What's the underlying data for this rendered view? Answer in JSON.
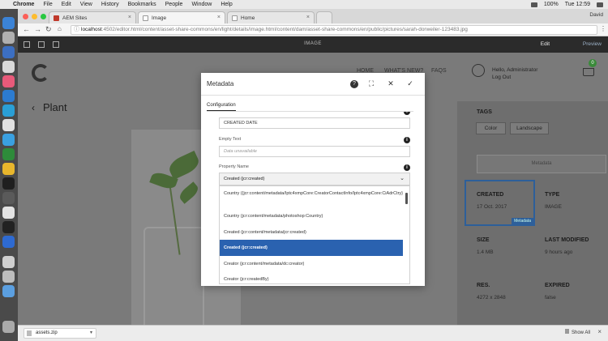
{
  "menubar": {
    "items": [
      "Chrome",
      "File",
      "Edit",
      "View",
      "History",
      "Bookmarks",
      "People",
      "Window",
      "Help"
    ],
    "battery": "100%",
    "clock": "Tue 12:59",
    "user": "David"
  },
  "browser": {
    "tabs": [
      {
        "label": "AEM Sites"
      },
      {
        "label": "Image"
      },
      {
        "label": "Home"
      }
    ],
    "person": "David",
    "url_host": "localhost",
    "url_rest": ":4502/editor.html/content/asset-share-commons/en/light/details/image.html/content/dam/asset-share-commons/en/public/pictures/sarah-dorweiler-123483.jpg"
  },
  "editor": {
    "title": "IMAGE",
    "edit_label": "Edit",
    "preview_label": "Preview"
  },
  "page": {
    "title": "Plant",
    "nav": [
      "HOME",
      "WHAT'S NEW?",
      "FAQS"
    ],
    "greeting": "Hello, Administrator",
    "logout": "Log Out",
    "cart_count": "0",
    "tags_label": "TAGS",
    "tags": [
      "Color",
      "Landscape"
    ],
    "metadata_box": "Metadata",
    "created_label": "CREATED",
    "created_value": "17 Oct. 2017",
    "metadata_tag": "Metadata",
    "type_label": "TYPE",
    "type_value": "IMAGE",
    "size_label": "SIZE",
    "size_value": "1.4 MB",
    "modified_label": "LAST MODIFIED",
    "modified_value": "9 hours ago",
    "res_label": "RES.",
    "res_value": "4272 x 2848",
    "expired_label": "EXPIRED",
    "expired_value": "false"
  },
  "modal": {
    "title": "Metadata",
    "tab": "Configuration",
    "label_field_value": "CREATED DATE",
    "empty_text_label": "Empty Text",
    "empty_text_placeholder": "Data unavailable",
    "property_name_label": "Property Name",
    "property_selected": "Created (jcr:created)",
    "options": [
      "Country ({jcr:content/metadata/Iptc4xmpCore:CreatorContactInfo/Iptc4xmpCore:CiAdrCtry}",
      "Country (jcr:content/metadata/photoshop:Country)",
      "Created (jcr:content/metadata/jcr:created)",
      "Created (jcr:created)",
      "Creator (jcr:content/metadata/dc:creator)",
      "Creator (jcr:createdBy)"
    ]
  },
  "downloads": {
    "file": "assets.zip",
    "show_all": "Show All"
  }
}
